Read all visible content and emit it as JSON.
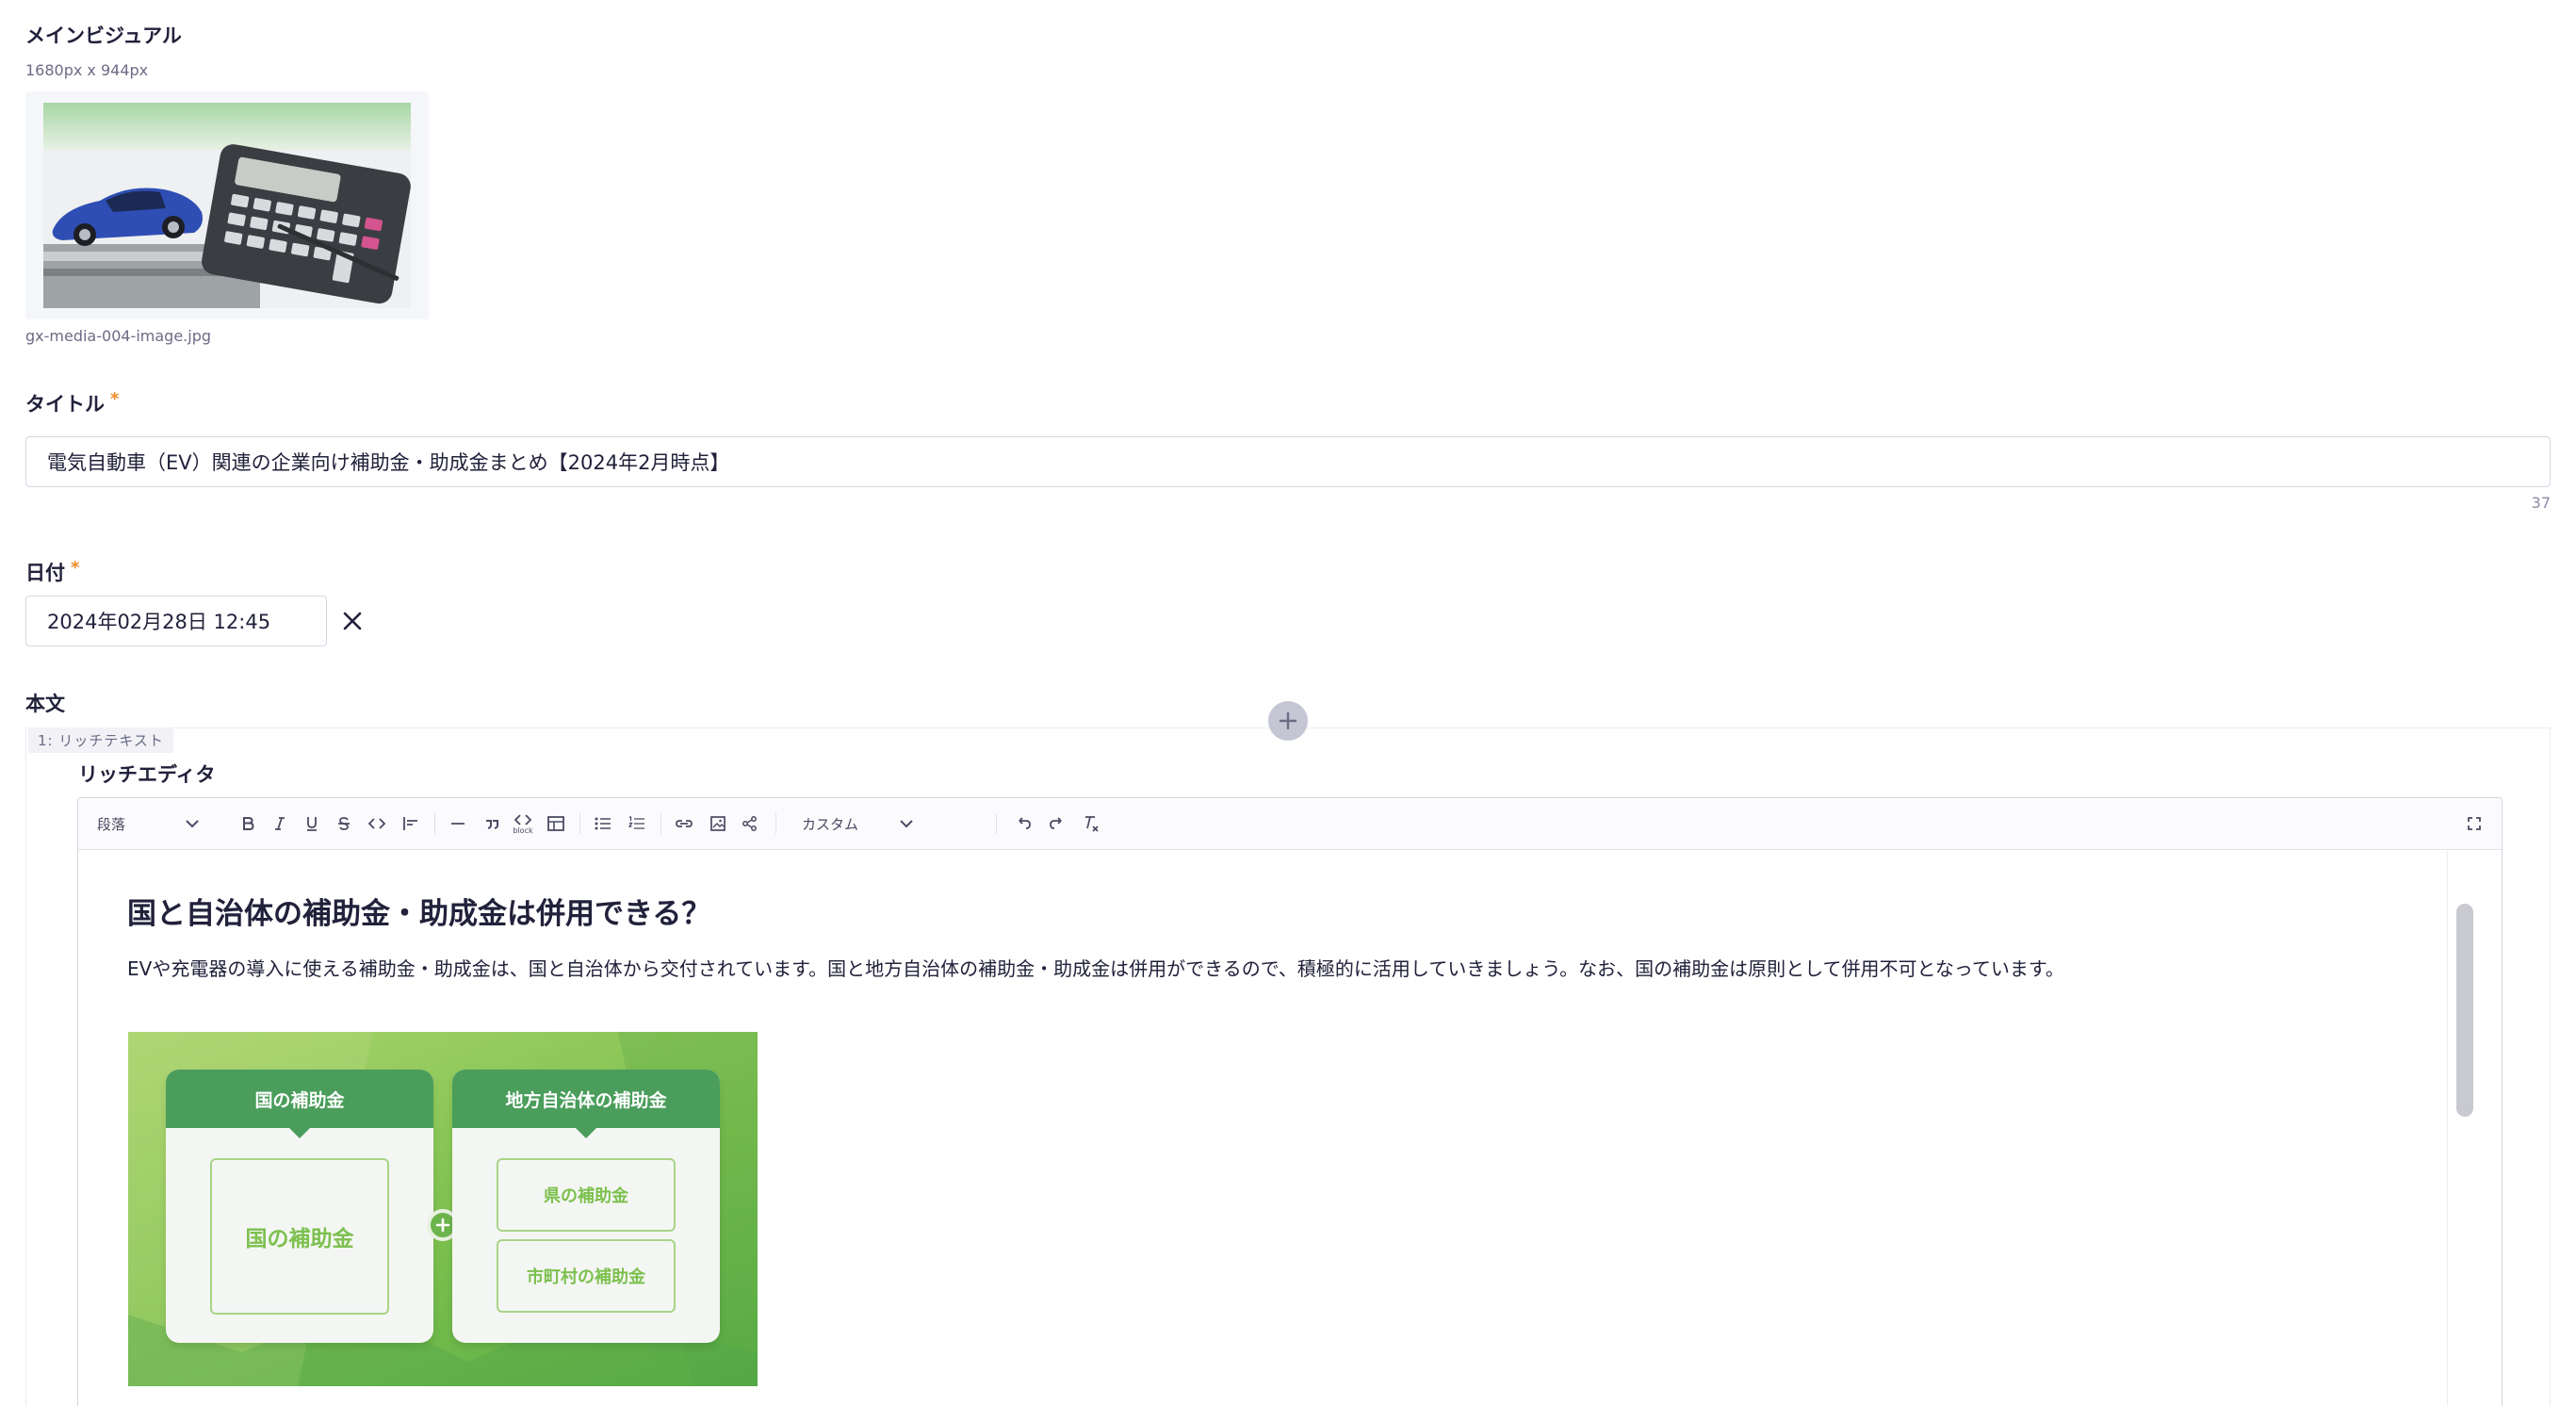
{
  "main_visual": {
    "label": "メインビジュアル",
    "size_note": "1680px x 944px",
    "filename": "gx-media-004-image.jpg"
  },
  "title_field": {
    "label": "タイトル",
    "required_mark": "*",
    "value": "電気自動車（EV）関連の企業向け補助金・助成金まとめ【2024年2月時点】",
    "char_count": "37"
  },
  "date_field": {
    "label": "日付",
    "required_mark": "*",
    "value": "2024年02月28日 12:45"
  },
  "body_field": {
    "label": "本文",
    "block_tag": "1: リッチテキスト",
    "rich_editor_label": "リッチエディタ"
  },
  "toolbar": {
    "paragraph_select": "段落",
    "custom_select": "カスタム",
    "code_block_caption": "block",
    "icons": [
      "bold-icon",
      "italic-icon",
      "underline-icon",
      "strikethrough-icon",
      "code-icon",
      "align-left-icon",
      "horizontal-rule-icon",
      "blockquote-icon",
      "code-block-icon",
      "table-icon",
      "bullet-list-icon",
      "numbered-list-icon",
      "link-icon",
      "image-icon",
      "share-icon",
      "undo-icon",
      "redo-icon",
      "clear-format-icon",
      "fullscreen-icon"
    ]
  },
  "content": {
    "heading": "国と自治体の補助金・助成金は併用できる？",
    "paragraph": "EVや充電器の導入に使える補助金・助成金は、国と自治体から交付されています。国と地方自治体の補助金・助成金は併用ができるので、積極的に活用していきましょう。なお、国の補助金は原則として併用不可となっています。"
  },
  "figure": {
    "left_card_title": "国の補助金",
    "left_card_body": "国の補助金",
    "right_card_title": "地方自治体の補助金",
    "right_card_item_1": "県の補助金",
    "right_card_item_2": "市町村の補助金"
  },
  "colors": {
    "accent_required": "#f08a24",
    "figure_green_dark": "#4a9d5b",
    "figure_green_light": "#7cc04e"
  }
}
